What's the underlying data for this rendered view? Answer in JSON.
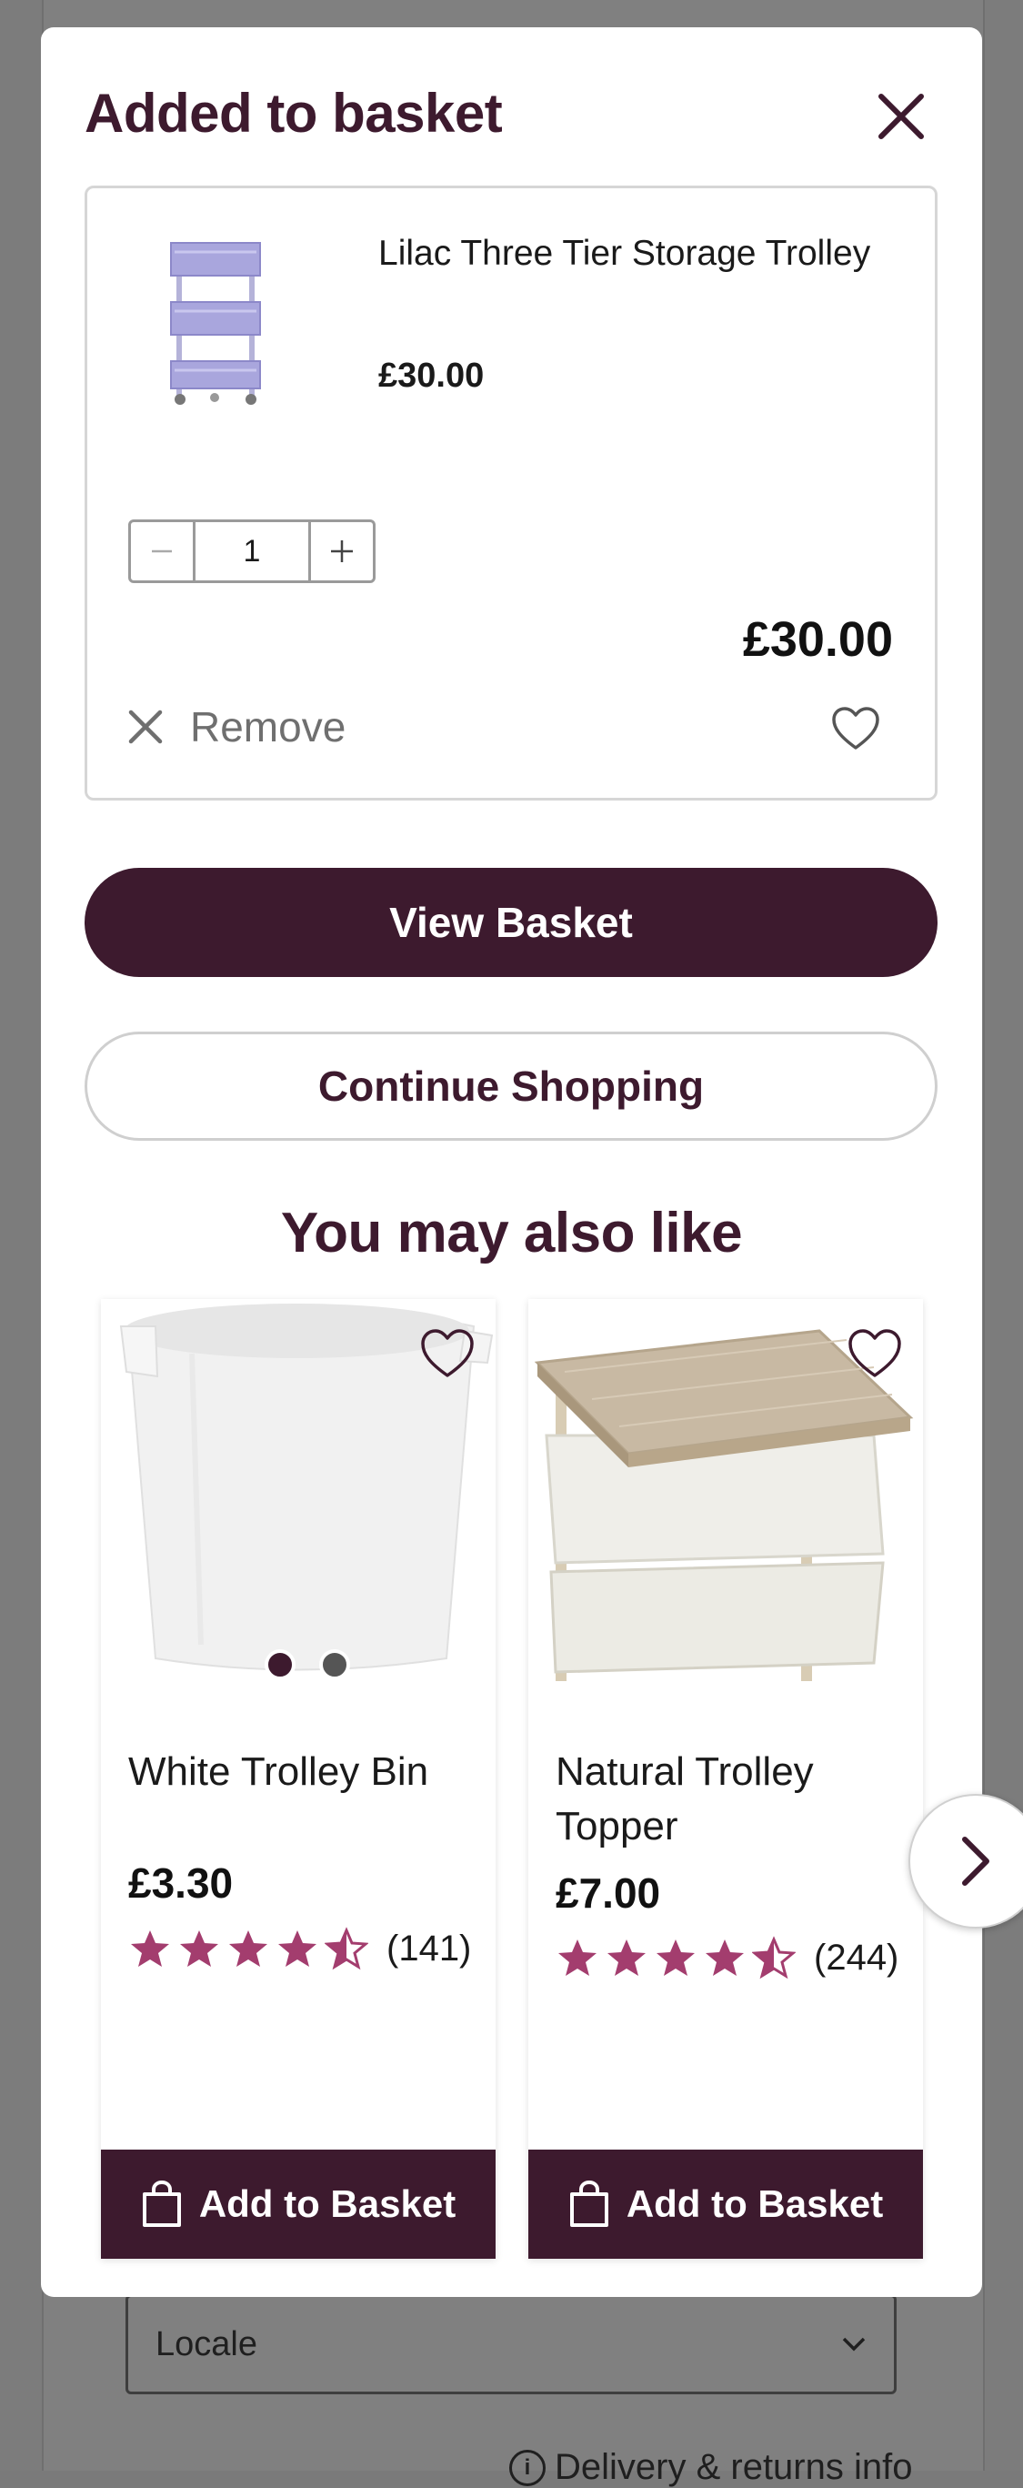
{
  "background": {
    "locale_label": "Locale",
    "footer_text": "Delivery & returns info"
  },
  "modal": {
    "title": "Added to basket",
    "item": {
      "name": "Lilac Three Tier Storage Trolley",
      "price": "£30.00",
      "quantity": "1",
      "line_total": "£30.00",
      "remove_label": "Remove"
    },
    "view_basket_label": "View Basket",
    "continue_label": "Continue Shopping"
  },
  "recommendations": {
    "title": "You may also like",
    "products": [
      {
        "name": "White Trolley Bin",
        "price": "£3.30",
        "rating": 4.5,
        "review_count": "(141)",
        "add_label": "Add to Basket"
      },
      {
        "name": "Natural Trolley Topper",
        "price": "£7.00",
        "rating": 4.5,
        "review_count": "(244)",
        "add_label": "Add to Basket"
      }
    ]
  },
  "colors": {
    "brand": "#3d1a2e",
    "star": "#a33d6e"
  }
}
